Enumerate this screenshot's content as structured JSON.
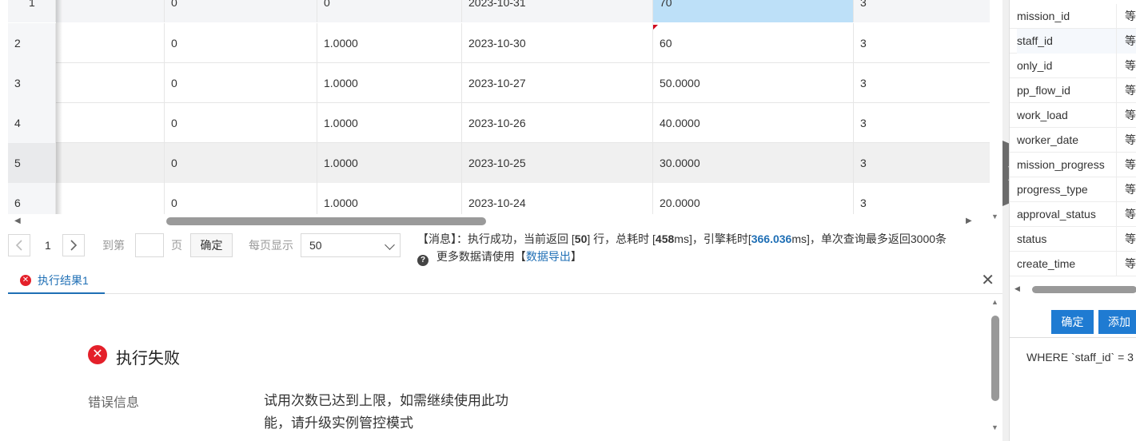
{
  "grid": {
    "rows": [
      {
        "num": "1",
        "c1": "",
        "c2": "0",
        "c3": "0",
        "c4": "2023-10-31",
        "c5": "70",
        "c6": "3"
      },
      {
        "num": "2",
        "c1": "",
        "c2": "0",
        "c3": "1.0000",
        "c4": "2023-10-30",
        "c5": "60",
        "c6": "3"
      },
      {
        "num": "3",
        "c1": "",
        "c2": "0",
        "c3": "1.0000",
        "c4": "2023-10-27",
        "c5": "50.0000",
        "c6": "3"
      },
      {
        "num": "4",
        "c1": "",
        "c2": "0",
        "c3": "1.0000",
        "c4": "2023-10-26",
        "c5": "40.0000",
        "c6": "3"
      },
      {
        "num": "5",
        "c1": "",
        "c2": "0",
        "c3": "1.0000",
        "c4": "2023-10-25",
        "c5": "30.0000",
        "c6": "3"
      },
      {
        "num": "6",
        "c1": "",
        "c2": "0",
        "c3": "1.0000",
        "c4": "2023-10-24",
        "c5": "20.0000",
        "c6": "3"
      }
    ]
  },
  "pager": {
    "current_page": "1",
    "goto_label": "到第",
    "page_unit": "页",
    "confirm_label": "确定",
    "per_page_label": "每页显示",
    "per_page_value": "50"
  },
  "message": {
    "prefix": "【消息】：执行成功，当前返回 [",
    "rows": "50",
    "mid1": "] 行，总耗时 [",
    "total_ms": "458",
    "mid2": "ms]，引擎耗时[",
    "engine_ms": "366.036",
    "suffix": "ms]，单次查询最多返回3000条",
    "line2_prefix": "更多数据请使用【",
    "export_link": "数据导出",
    "line2_suffix": "】"
  },
  "result_tab": {
    "label": "执行结果1"
  },
  "result": {
    "title": "执行失败",
    "error_label": "错误信息",
    "error_text": "试用次数已达到上限，如需继续使用此功能，请升级实例管控模式"
  },
  "right_panel": {
    "fields": [
      {
        "name": "mission_id",
        "op": "等于"
      },
      {
        "name": "staff_id",
        "op": "等于"
      },
      {
        "name": "only_id",
        "op": "等于"
      },
      {
        "name": "pp_flow_id",
        "op": "等于"
      },
      {
        "name": "work_load",
        "op": "等于"
      },
      {
        "name": "worker_date",
        "op": "等于"
      },
      {
        "name": "mission_progress",
        "op": "等于"
      },
      {
        "name": "progress_type",
        "op": "等于"
      },
      {
        "name": "approval_status",
        "op": "等于"
      },
      {
        "name": "status",
        "op": "等于"
      },
      {
        "name": "create_time",
        "op": "等于"
      }
    ],
    "confirm_label": "确定",
    "add_label": "添加",
    "where_sql": "WHERE `staff_id` = 3"
  }
}
